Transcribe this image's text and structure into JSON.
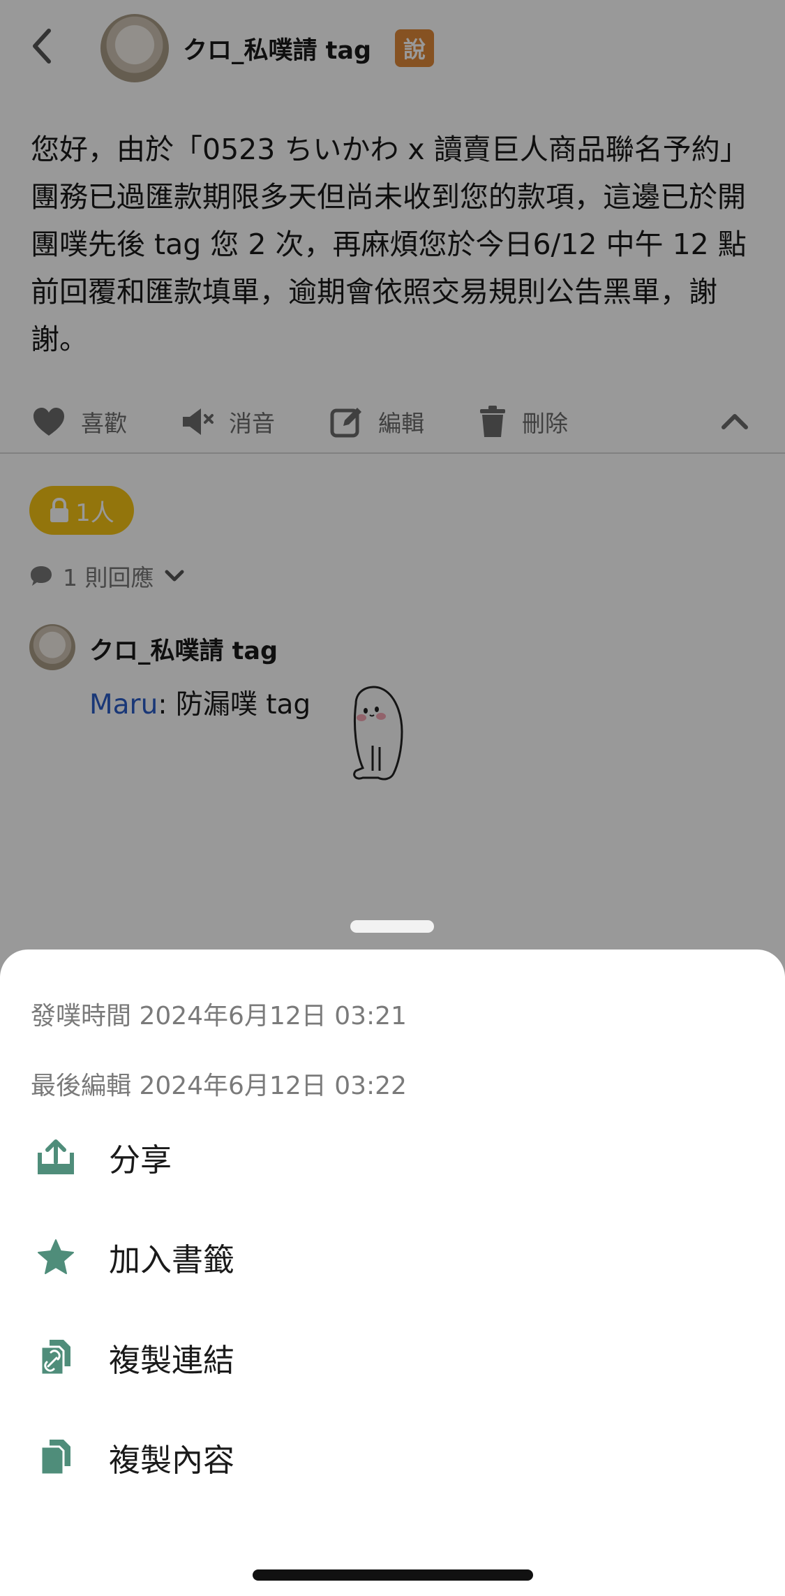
{
  "header": {
    "username": "クロ_私噗請 tag",
    "badge": "說"
  },
  "post": {
    "text": "您好，由於「0523 ちいかわ x 讀賣巨人商品聯名予約」團務已過匯款期限多天但尚未收到您的款項，這邊已於開團噗先後 tag 您 2 次，再麻煩您於今日6/12 中午 12 點前回覆和匯款填單，逾期會依照交易規則公告黑單，謝謝。"
  },
  "actions": {
    "like": "喜歡",
    "mute": "消音",
    "edit": "編輯",
    "delete": "刪除"
  },
  "privacy": {
    "label": "1人"
  },
  "replies": {
    "count_label": "1 則回應",
    "items": [
      {
        "user": "クロ_私噗請 tag",
        "mention": "Maru",
        "text": ": 防漏噗 tag"
      }
    ]
  },
  "sheet": {
    "posted": "發噗時間 2024年6月12日 03:21",
    "edited": "最後編輯 2024年6月12日 03:22",
    "menu": [
      {
        "label": "分享",
        "icon": "share-icon"
      },
      {
        "label": "加入書籤",
        "icon": "star-icon"
      },
      {
        "label": "複製連結",
        "icon": "copy-link-icon"
      },
      {
        "label": "複製內容",
        "icon": "copy-content-icon"
      }
    ]
  },
  "colors": {
    "accent_green": "#4f8d7a",
    "badge_orange": "#e0893a",
    "lock_yellow": "#f5c414",
    "mention_blue": "#2a5cc7"
  }
}
